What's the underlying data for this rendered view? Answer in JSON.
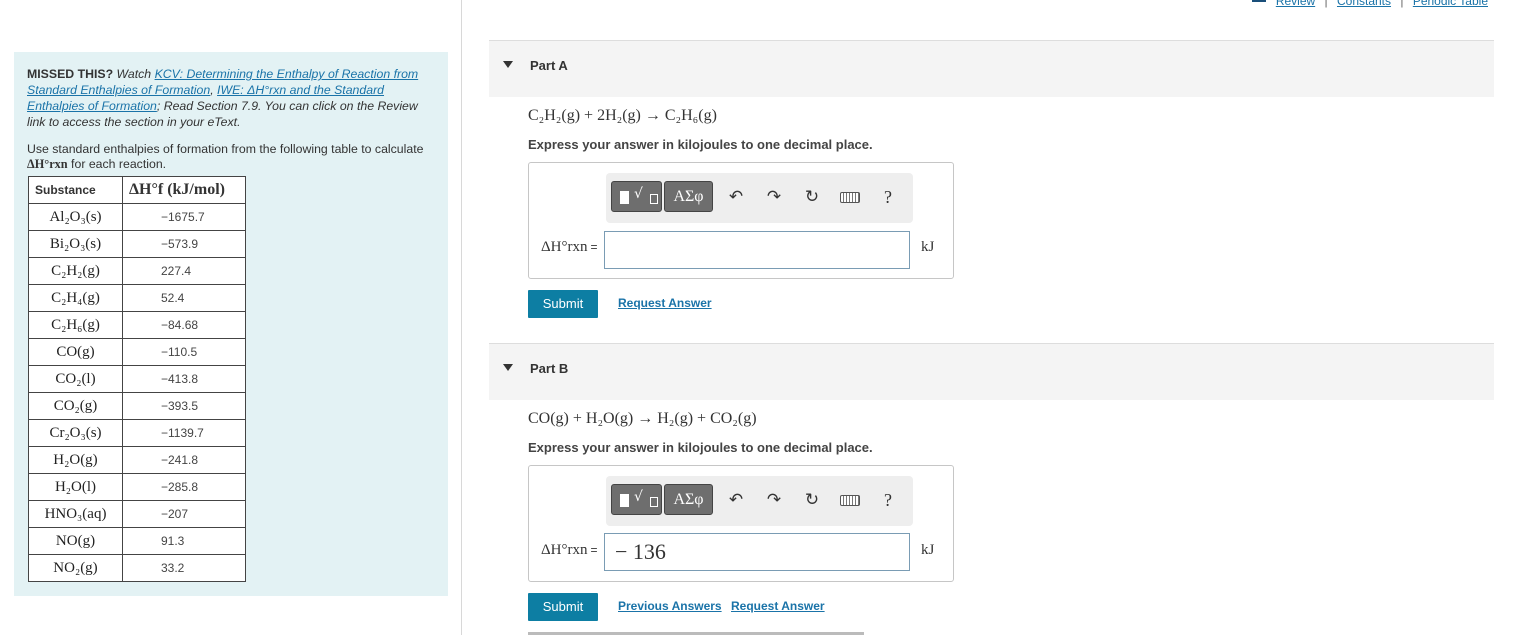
{
  "top_links": [
    "Review",
    "Constants",
    "Periodic Table"
  ],
  "left": {
    "missed_prefix": "MISSED THIS?",
    "missed_watch": " Watch ",
    "kcv_link": "KCV: Determining the Enthalpy of Reaction from Standard Enthalpies of Formation",
    "sep1": ", ",
    "iwe_link": "IWE: ΔH°rxn and the Standard Enthalpies of Formation",
    "read_text": "; Read Section 7.9. You can click on the Review link to access the section in your eText.",
    "instruction_pre": "Use standard enthalpies of formation from the following table to calculate ",
    "instruction_sym": "ΔH°rxn",
    "instruction_post": " for each reaction.",
    "table": {
      "header_substance": "Substance",
      "header_value": "ΔH°f (kJ/mol)",
      "rows": [
        {
          "substance": "Al₂O₃(s)",
          "value": "−1675.7"
        },
        {
          "substance": "Bi₂O₃(s)",
          "value": "−573.9"
        },
        {
          "substance": "C₂H₂(g)",
          "value": "227.4"
        },
        {
          "substance": "C₂H₄(g)",
          "value": "52.4"
        },
        {
          "substance": "C₂H₆(g)",
          "value": "−84.68"
        },
        {
          "substance": "CO(g)",
          "value": "−110.5"
        },
        {
          "substance": "CO₂(l)",
          "value": "−413.8"
        },
        {
          "substance": "CO₂(g)",
          "value": "−393.5"
        },
        {
          "substance": "Cr₂O₃(s)",
          "value": "−1139.7"
        },
        {
          "substance": "H₂O(g)",
          "value": "−241.8"
        },
        {
          "substance": "H₂O(l)",
          "value": "−285.8"
        },
        {
          "substance": "HNO₃(aq)",
          "value": "−207"
        },
        {
          "substance": "NO(g)",
          "value": "91.3"
        },
        {
          "substance": "NO₂(g)",
          "value": "33.2"
        }
      ]
    }
  },
  "parts": [
    {
      "label": "Part A",
      "equation": "C₂H₂(g) + 2H₂(g) → C₂H₆(g)",
      "instruction": "Express your answer in kilojoules to one decimal place.",
      "greek_label": "ΑΣφ",
      "help_label": "?",
      "answer_label": "ΔH°rxn",
      "equals": "=",
      "answer_value": "",
      "unit": "kJ",
      "submit_label": "Submit",
      "links": [
        "Request Answer"
      ]
    },
    {
      "label": "Part B",
      "equation": "CO(g) + H₂O(g) → H₂(g) + CO₂(g)",
      "instruction": "Express your answer in kilojoules to one decimal place.",
      "greek_label": "ΑΣφ",
      "help_label": "?",
      "answer_label": "ΔH°rxn",
      "equals": "=",
      "answer_value": "− 136",
      "unit": "kJ",
      "submit_label": "Submit",
      "links": [
        "Previous Answers",
        "Request Answer"
      ]
    }
  ]
}
